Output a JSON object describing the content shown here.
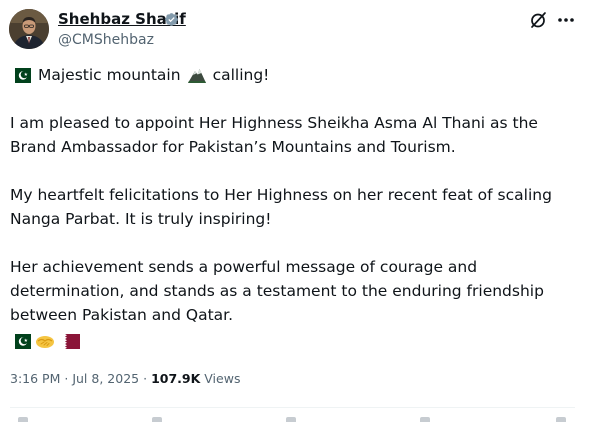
{
  "author": {
    "display_name": "Shehbaz Sharif",
    "handle": "@CMShehbaz",
    "verified": true,
    "avatar_icon": "portrait-avatar"
  },
  "header_actions": {
    "grok_icon": "grok-icon",
    "more_icon": "more-horizontal-icon"
  },
  "post": {
    "line1_before": "Majestic mountain",
    "line1_after": "calling!",
    "paragraph2": "I am pleased to appoint Her Highness Sheikha Asma Al Thani as the Brand Ambassador for Pakistan’s Mountains and Tourism.",
    "paragraph3": "My heartfelt felicitations to Her Highness on her recent feat of scaling Nanga Parbat. It is truly inspiring!",
    "paragraph4": "Her achievement sends a powerful message of courage and determination, and stands as a testament to the enduring friendship between Pakistan and Qatar.",
    "emojis": [
      "pakistan-flag-icon",
      "handshake-icon",
      "qatar-flag-icon"
    ]
  },
  "meta": {
    "time": "3:16 PM",
    "separator": "·",
    "date": "Jul 8, 2025",
    "views_count": "107.9K",
    "views_label": "Views"
  },
  "colors": {
    "text_primary": "#0f1419",
    "text_secondary": "#536471",
    "verified_badge": "#829aab",
    "pakistan_green": "#01411c",
    "qatar_maroon": "#8a1538",
    "handshake_yellow": "#f5c542"
  }
}
